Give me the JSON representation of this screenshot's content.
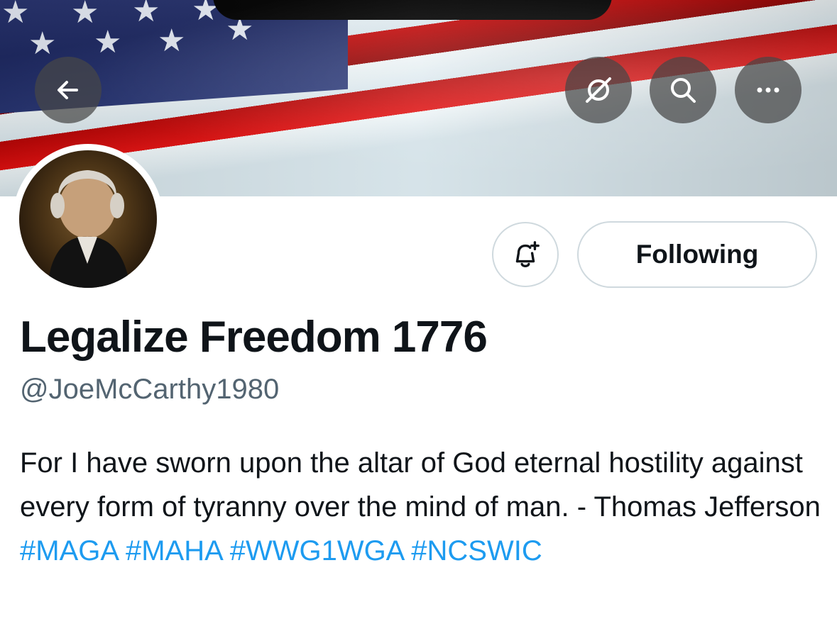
{
  "profile": {
    "display_name": "Legalize Freedom 1776",
    "handle": "@JoeMcCarthy1980",
    "bio_text": "For I have sworn upon the altar of God eternal hostility against every form of tyranny over the mind of man. - Thomas Jefferson",
    "hashtags": [
      "#MAGA",
      "#MAHA",
      "#WWG1WGA",
      "#NCSWIC"
    ]
  },
  "actions": {
    "follow_label": "Following"
  },
  "icons": {
    "back": "arrow-left-icon",
    "grok": "grok-icon",
    "search": "search-icon",
    "more": "more-icon",
    "notify": "bell-plus-icon"
  },
  "colors": {
    "link": "#1d9bf0",
    "text_primary": "#0f1419",
    "text_secondary": "#536471",
    "border": "#cfd9de"
  }
}
